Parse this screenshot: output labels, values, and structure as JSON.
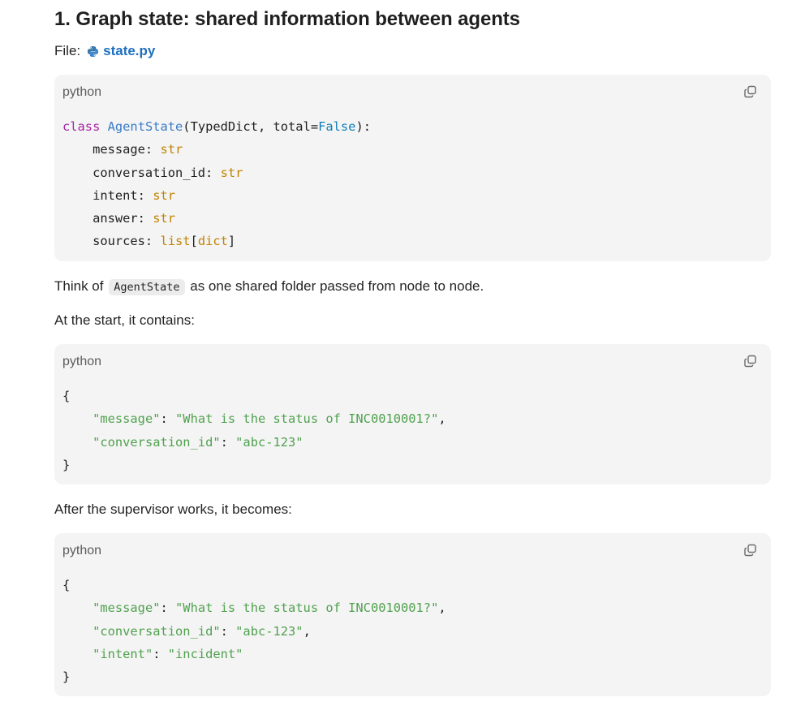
{
  "heading": "1. Graph state: shared information between agents",
  "file": {
    "label": "File:",
    "name": "state.py",
    "icon": "python-icon"
  },
  "code_blocks": [
    {
      "language": "python",
      "copy_icon": "copy-icon",
      "lines": [
        [
          {
            "t": "class",
            "c": "kw"
          },
          {
            "t": " "
          },
          {
            "t": "AgentState",
            "c": "cls"
          },
          {
            "t": "(TypedDict, total="
          },
          {
            "t": "False",
            "c": "bool"
          },
          {
            "t": "):"
          }
        ],
        [
          {
            "t": "    message: "
          },
          {
            "t": "str",
            "c": "ty"
          }
        ],
        [
          {
            "t": "    conversation_id: "
          },
          {
            "t": "str",
            "c": "ty"
          }
        ],
        [
          {
            "t": "    intent: "
          },
          {
            "t": "str",
            "c": "ty"
          }
        ],
        [
          {
            "t": "    answer: "
          },
          {
            "t": "str",
            "c": "ty"
          }
        ],
        [
          {
            "t": "    sources: "
          },
          {
            "t": "list",
            "c": "ty"
          },
          {
            "t": "["
          },
          {
            "t": "dict",
            "c": "ty"
          },
          {
            "t": "]"
          }
        ]
      ]
    },
    {
      "language": "python",
      "copy_icon": "copy-icon",
      "lines": [
        [
          {
            "t": "{"
          }
        ],
        [
          {
            "t": "    "
          },
          {
            "t": "\"message\"",
            "c": "str"
          },
          {
            "t": ": "
          },
          {
            "t": "\"What is the status of INC0010001?\"",
            "c": "str"
          },
          {
            "t": ","
          }
        ],
        [
          {
            "t": "    "
          },
          {
            "t": "\"conversation_id\"",
            "c": "str"
          },
          {
            "t": ": "
          },
          {
            "t": "\"abc-123\"",
            "c": "str"
          }
        ],
        [
          {
            "t": "}"
          }
        ]
      ]
    },
    {
      "language": "python",
      "copy_icon": "copy-icon",
      "lines": [
        [
          {
            "t": "{"
          }
        ],
        [
          {
            "t": "    "
          },
          {
            "t": "\"message\"",
            "c": "str"
          },
          {
            "t": ": "
          },
          {
            "t": "\"What is the status of INC0010001?\"",
            "c": "str"
          },
          {
            "t": ","
          }
        ],
        [
          {
            "t": "    "
          },
          {
            "t": "\"conversation_id\"",
            "c": "str"
          },
          {
            "t": ": "
          },
          {
            "t": "\"abc-123\"",
            "c": "str"
          },
          {
            "t": ","
          }
        ],
        [
          {
            "t": "    "
          },
          {
            "t": "\"intent\"",
            "c": "str"
          },
          {
            "t": ": "
          },
          {
            "t": "\"incident\"",
            "c": "str"
          }
        ],
        [
          {
            "t": "}"
          }
        ]
      ]
    }
  ],
  "paragraphs": {
    "think_of_prefix": "Think of",
    "think_of_code": "AgentState",
    "think_of_suffix": "as one shared folder passed from node to node.",
    "at_start": "At the start, it contains:",
    "after_supervisor": "After the supervisor works, it becomes:"
  },
  "colors": {
    "keyword": "#a626a4",
    "class_name": "#3a7bc8",
    "type": "#c18401",
    "boolean": "#0e7fb8",
    "string": "#50a14f",
    "link": "#1f6fbf",
    "code_background": "#f4f4f4"
  }
}
